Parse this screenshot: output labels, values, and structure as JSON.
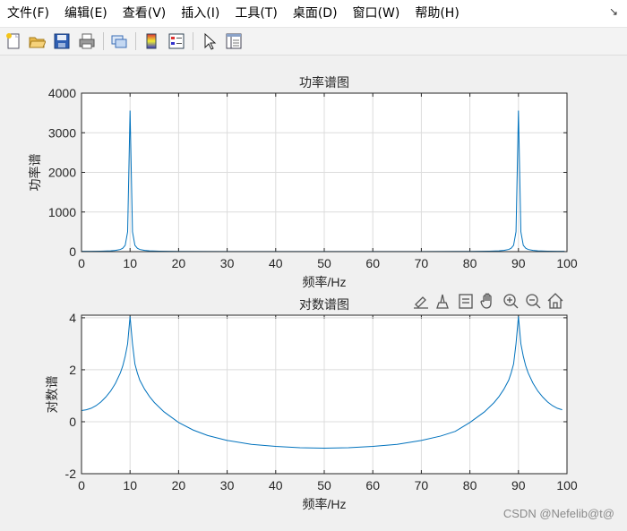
{
  "menubar": {
    "items": [
      "文件(F)",
      "编辑(E)",
      "查看(V)",
      "插入(I)",
      "工具(T)",
      "桌面(D)",
      "窗口(W)",
      "帮助(H)"
    ],
    "overflow_icon": "dock-arrow-icon"
  },
  "toolbar": {
    "icons": [
      "new-figure-icon",
      "open-file-icon",
      "save-icon",
      "print-icon",
      "link-icon",
      "colorbar-icon",
      "legend-icon",
      "pointer-icon",
      "property-inspector-icon"
    ]
  },
  "axes_toolbar": {
    "icons": [
      "brush-icon",
      "data-tips-icon",
      "export-icon",
      "pan-hand-icon",
      "zoom-in-icon",
      "zoom-out-icon",
      "home-icon"
    ]
  },
  "chart_data": [
    {
      "type": "line",
      "title": "功率谱图",
      "xlabel": "频率/Hz",
      "ylabel": "功率谱",
      "xlim": [
        0,
        100
      ],
      "ylim": [
        0,
        4000
      ],
      "xticks": [
        "0",
        "10",
        "20",
        "30",
        "40",
        "50",
        "60",
        "70",
        "80",
        "90",
        "100"
      ],
      "yticks": [
        "0",
        "1000",
        "2000",
        "3000",
        "4000"
      ],
      "grid": true,
      "color": "#0072bd",
      "series": [
        {
          "x": [
            0,
            2,
            4,
            6,
            7,
            8,
            8.5,
            9,
            9.5,
            10,
            10.5,
            11,
            11.5,
            12,
            13,
            14,
            16,
            20,
            30,
            40,
            50,
            60,
            70,
            80,
            84,
            86,
            87,
            88,
            88.5,
            89,
            89.5,
            90,
            90.5,
            91,
            91.5,
            92,
            93,
            94,
            96,
            98,
            99.5
          ],
          "values": [
            8,
            9,
            12,
            20,
            30,
            55,
            85,
            160,
            500,
            3560,
            500,
            160,
            85,
            55,
            30,
            20,
            12,
            6,
            3,
            2,
            2,
            2,
            3,
            6,
            12,
            20,
            30,
            55,
            85,
            160,
            500,
            3560,
            500,
            160,
            85,
            55,
            30,
            20,
            12,
            9,
            8
          ]
        }
      ]
    },
    {
      "type": "line",
      "title": "对数谱图",
      "xlabel": "频率/Hz",
      "ylabel": "对数谱",
      "xlim": [
        0,
        100
      ],
      "ylim": [
        -2,
        4.1
      ],
      "xticks": [
        "0",
        "10",
        "20",
        "30",
        "40",
        "50",
        "60",
        "70",
        "80",
        "90",
        "100"
      ],
      "yticks": [
        "-2",
        "0",
        "2",
        "4"
      ],
      "grid": true,
      "color": "#0072bd",
      "series": [
        {
          "x": [
            0,
            1,
            2,
            3,
            4,
            5,
            6,
            7,
            8,
            8.5,
            9,
            9.5,
            10,
            10.5,
            11,
            11.5,
            12,
            13,
            14,
            15,
            17,
            20,
            23,
            26,
            30,
            35,
            40,
            45,
            50,
            55,
            60,
            65,
            70,
            74,
            77,
            80,
            83,
            85,
            86,
            87,
            88,
            88.5,
            89,
            89.5,
            90,
            90.5,
            91,
            91.5,
            92,
            93,
            94,
            95,
            96,
            97,
            98,
            99
          ],
          "values": [
            0.43,
            0.46,
            0.52,
            0.62,
            0.76,
            0.95,
            1.18,
            1.48,
            1.88,
            2.15,
            2.52,
            3.0,
            4.05,
            3.0,
            2.22,
            1.88,
            1.6,
            1.25,
            0.97,
            0.74,
            0.38,
            -0.03,
            -0.32,
            -0.53,
            -0.72,
            -0.87,
            -0.95,
            -1.0,
            -1.02,
            -1.0,
            -0.95,
            -0.87,
            -0.72,
            -0.55,
            -0.37,
            -0.03,
            0.38,
            0.74,
            0.97,
            1.25,
            1.6,
            1.88,
            2.22,
            3.0,
            4.05,
            3.0,
            2.52,
            2.15,
            1.88,
            1.48,
            1.18,
            0.95,
            0.76,
            0.62,
            0.52,
            0.46
          ]
        }
      ]
    }
  ],
  "watermark": "CSDN @Nefelib@t@"
}
